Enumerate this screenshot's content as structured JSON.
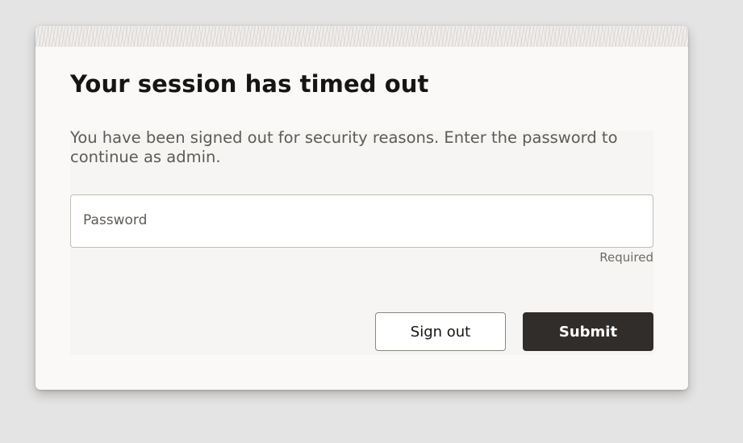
{
  "dialog": {
    "title": "Your session has timed out",
    "message": "You have been signed out for security reasons. Enter the password to continue as admin.",
    "password_field": {
      "label": "Password",
      "value": "",
      "helper": "Required"
    },
    "buttons": {
      "sign_out": "Sign out",
      "submit": "Submit"
    }
  },
  "colors": {
    "page_background": "#e4e4e4",
    "dialog_background": "#faf9f8",
    "primary_button": "#312d2a",
    "text_primary": "#161513",
    "text_secondary": "#5e5b57"
  }
}
